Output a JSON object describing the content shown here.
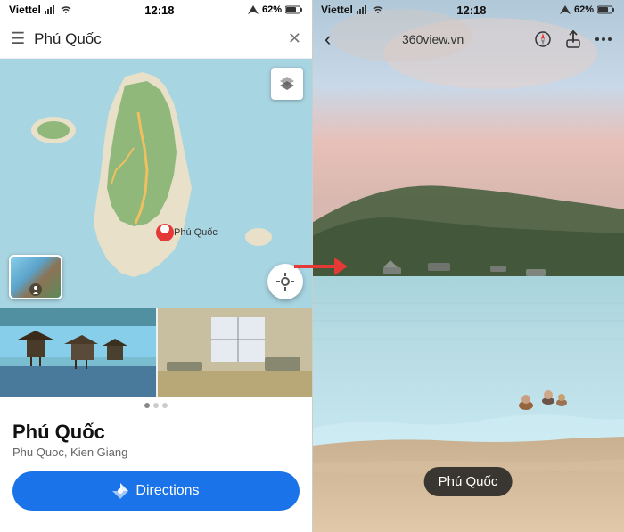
{
  "left": {
    "status": {
      "carrier": "Viettel",
      "time": "12:18",
      "battery": "62%"
    },
    "search": {
      "placeholder": "Phú Quốc",
      "menu_label": "☰",
      "close_label": "✕"
    },
    "map": {
      "layer_icon": "⊕",
      "location_icon": "◎"
    },
    "place": {
      "name": "Phú Quốc",
      "subtitle": "Phu Quoc, Kien Giang"
    },
    "directions": {
      "label": "Directions",
      "icon": "◈"
    }
  },
  "right": {
    "status": {
      "carrier": "Viettel",
      "time": "12:18",
      "battery": "62%"
    },
    "topbar": {
      "back": "‹",
      "url": "360view.vn",
      "compass_icon": "⊕",
      "share_icon": "⬆",
      "more_icon": "..."
    },
    "location_label": "Phú Quốc"
  },
  "arrow": {
    "color": "#e53935"
  }
}
